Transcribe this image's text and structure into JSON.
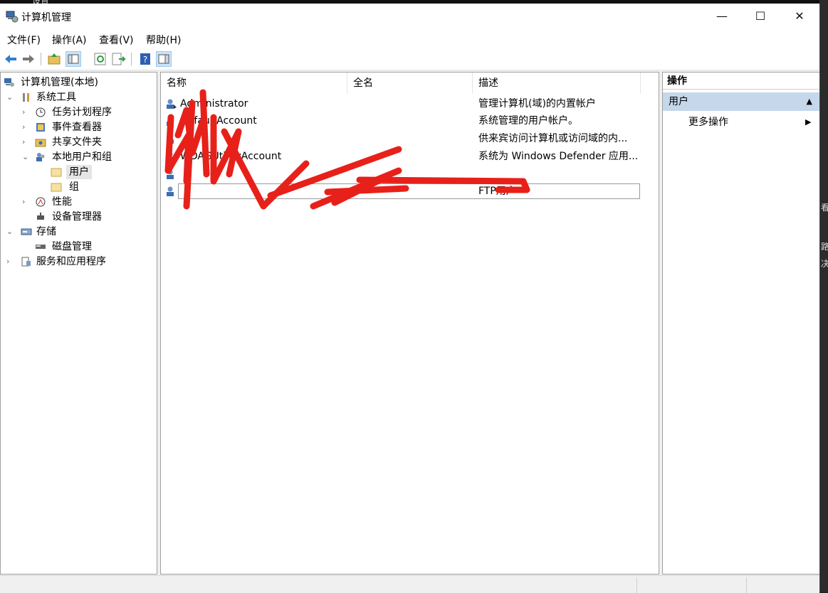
{
  "window": {
    "title": "计算机管理"
  },
  "window_controls": {
    "minimize": "—",
    "maximize": "☐",
    "close": "✕"
  },
  "menu": [
    "文件(F)",
    "操作(A)",
    "查看(V)",
    "帮助(H)"
  ],
  "tree": {
    "root": "计算机管理(本地)",
    "system_tools": "系统工具",
    "task_scheduler": "任务计划程序",
    "event_viewer": "事件查看器",
    "shared_folders": "共享文件夹",
    "local_users_groups": "本地用户和组",
    "users": "用户",
    "groups": "组",
    "performance": "性能",
    "device_manager": "设备管理器",
    "storage": "存储",
    "disk_management": "磁盘管理",
    "services_apps": "服务和应用程序"
  },
  "list": {
    "columns": [
      "名称",
      "全名",
      "描述"
    ],
    "rows": [
      {
        "name": "Administrator",
        "fullname": "",
        "desc": "管理计算机(域)的内置帐户"
      },
      {
        "name": "DefaultAccount",
        "fullname": "",
        "desc": "系统管理的用户帐户。"
      },
      {
        "name": "",
        "fullname": "",
        "desc": "供来宾访问计算机或访问域的内..."
      },
      {
        "name": "WDAGUtilityAccount",
        "fullname": "",
        "desc": "系统为 Windows Defender 应用..."
      },
      {
        "name": "",
        "fullname": "",
        "desc": ""
      },
      {
        "name": "",
        "fullname": "",
        "desc": "FTP用户"
      }
    ]
  },
  "actions": {
    "header": "操作",
    "section": "用户",
    "more": "更多操作",
    "collapse_glyph": "▲",
    "more_glyph": "▶"
  },
  "background_text": {
    "top": "设置",
    "right1": "看",
    "right2": "路",
    "right3": "决"
  },
  "colors": {
    "accent_selection": "#c5d7ea",
    "scribble": "#e8201a"
  }
}
